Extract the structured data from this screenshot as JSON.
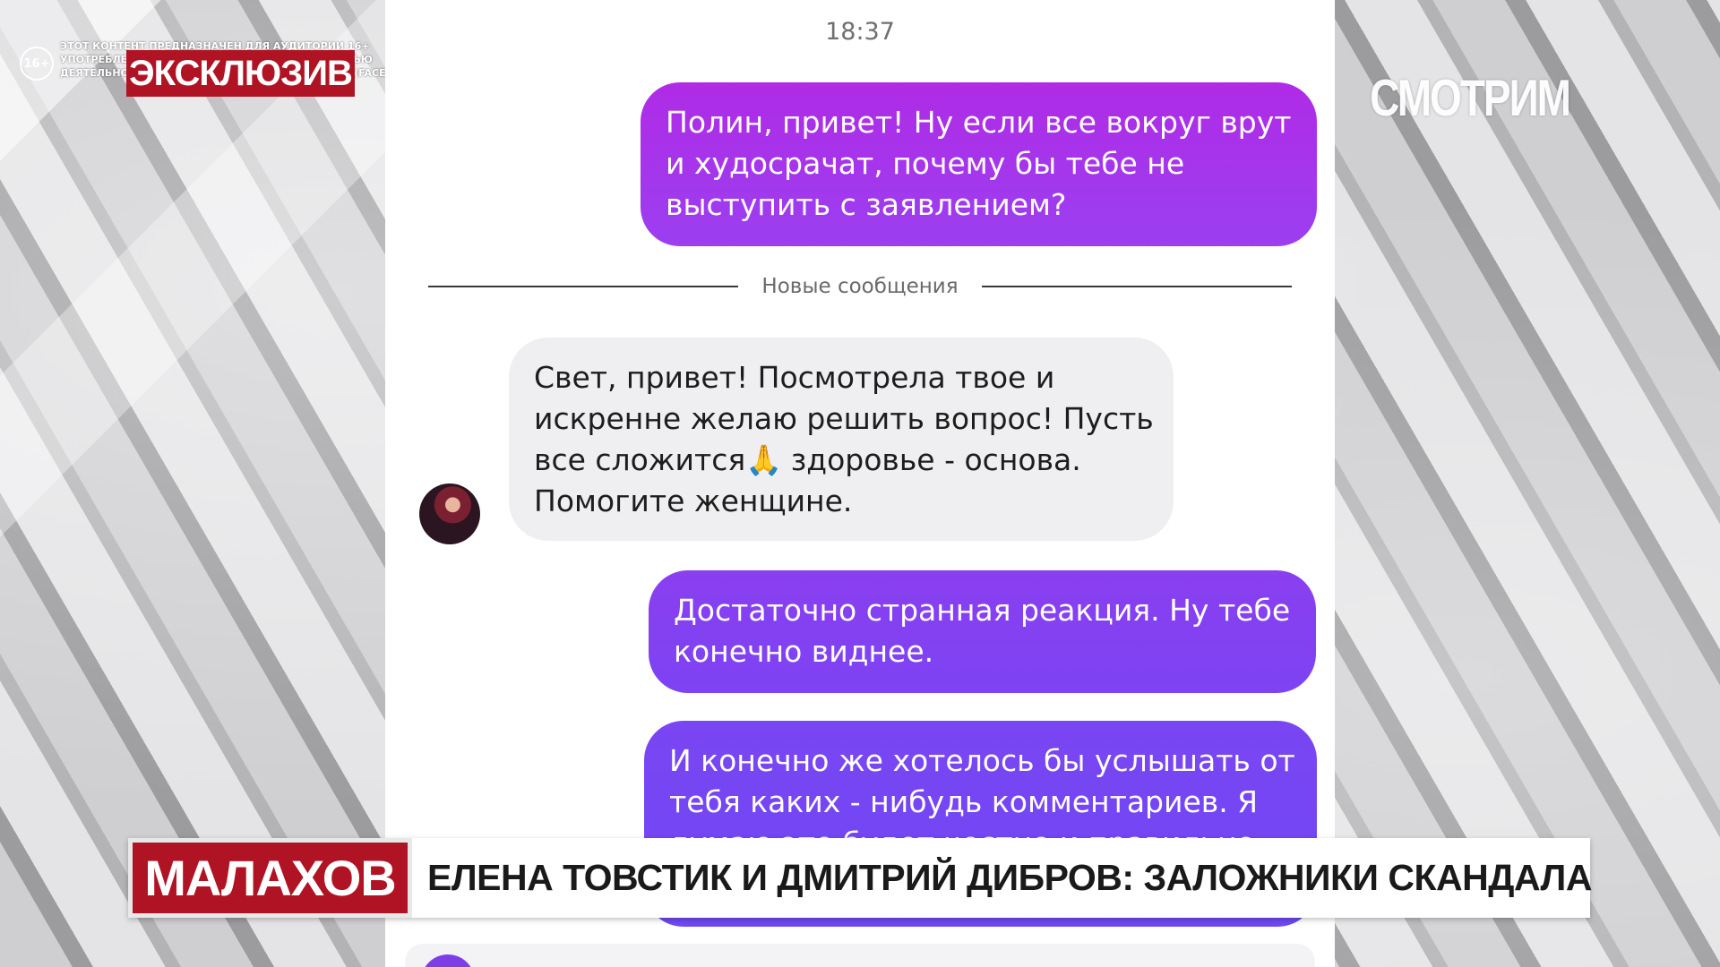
{
  "overlay": {
    "age_rating": "16+",
    "disclaimer_lines": [
      "ЭТОТ КОНТЕНТ ПРЕДНАЗНАЧЕН ДЛЯ АУДИТОРИИ 16+",
      "УПОТРЕБЛЕНИЕ ТАБАКА ВРЕДИТ ВАШЕМУ ЗДОРОВЬЮ",
      "ДЕЯТЕЛЬНОСТЬ КОМПАНИИ META PLATFORMS INC. (FACEBOOK, INSTAGRAM) НА ТЕРРИТОРИИ РОССИИ ЗАПРЕЩЕНА"
    ],
    "exclusive_label": "ЭКСКЛЮЗИВ",
    "channel_logo": "СМОТРИМ"
  },
  "chat": {
    "timestamp": "18:37",
    "messages": [
      {
        "lines": [
          "Полин, привет! Ну если все вокруг врут",
          "и худосрачат, почему бы тебе не",
          "выступить с заявлением?"
        ]
      },
      {
        "lines": [
          "Свет, привет!  Посмотрела твое и",
          "искренне желаю решить вопрос! Пусть",
          "все сложится",
          "здоровье - основа.",
          "Помогите женщине."
        ],
        "emoji_icon": "folded-hands-emoji"
      },
      {
        "lines": [
          "Достаточно странная реакция. Ну тебе",
          "конечно виднее."
        ]
      },
      {
        "lines": [
          "И конечно же хотелось бы услышать от",
          "тебя каких - нибудь комментариев. Я",
          "думаю это будет честно и правильно"
        ]
      }
    ],
    "new_messages_divider": "Новые сообщения"
  },
  "lower_third": {
    "show_name": "МАЛАХОВ",
    "headline": "ЕЛЕНА ТОВСТИК И ДМИТРИЙ ДИБРОВ: ЗАЛОЖНИКИ СКАНДАЛА"
  },
  "colors": {
    "brand_red": "#b01424",
    "outgoing_bubble_top": "#b02be6",
    "outgoing_bubble_bottom": "#6f48f4",
    "incoming_bubble": "#efeff1"
  }
}
